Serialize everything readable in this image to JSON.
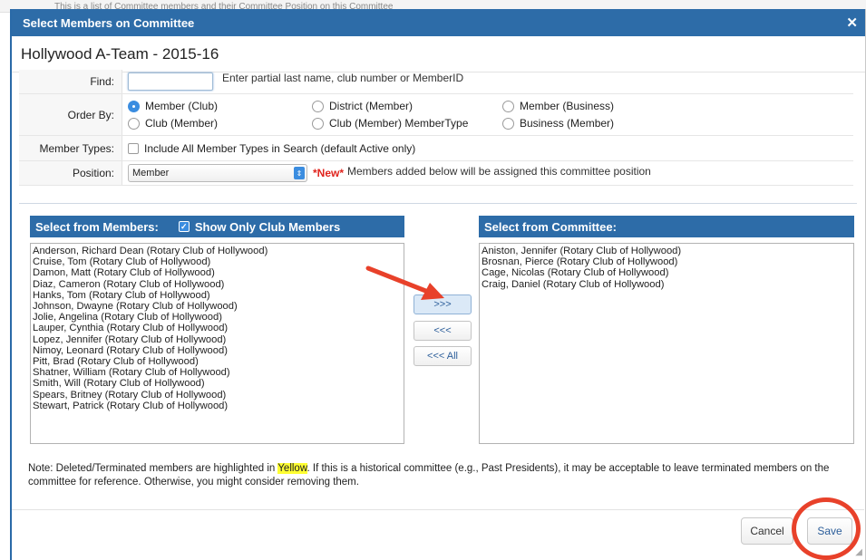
{
  "page": {
    "background_text": "This is a list of Committee members and their Committee Position on this Committee"
  },
  "modal": {
    "title": "Select Members on Committee",
    "close_icon": "close-icon"
  },
  "committee_title": "Hollywood A-Team - 2015-16",
  "form": {
    "find_label": "Find:",
    "find_value": "",
    "find_hint": "Enter partial last name, club number or MemberID",
    "order_by_label": "Order By:",
    "order_options": [
      {
        "label": "Member (Club)",
        "selected": true
      },
      {
        "label": "District (Member)",
        "selected": false
      },
      {
        "label": "Member (Business)",
        "selected": false
      },
      {
        "label": "Club (Member)",
        "selected": false
      },
      {
        "label": "Club (Member) MemberType",
        "selected": false
      },
      {
        "label": "Business (Member)",
        "selected": false
      }
    ],
    "member_types_label": "Member Types:",
    "member_types_checkbox": "Include All Member Types in Search (default Active only)",
    "position_label": "Position:",
    "position_value": "Member",
    "new_tag": "*New*",
    "position_hint": "Members added below will be assigned this committee position"
  },
  "members_panel": {
    "title": "Select from Members:",
    "show_only_label": "Show Only Club Members",
    "show_only_checked": true,
    "items": [
      "Anderson, Richard Dean (Rotary Club of Hollywood)",
      "Cruise, Tom (Rotary Club of Hollywood)",
      "Damon, Matt (Rotary Club of Hollywood)",
      "Diaz, Cameron (Rotary Club of Hollywood)",
      "Hanks, Tom (Rotary Club of Hollywood)",
      "Johnson, Dwayne (Rotary Club of Hollywood)",
      "Jolie, Angelina (Rotary Club of Hollywood)",
      "Lauper, Cynthia (Rotary Club of Hollywood)",
      "Lopez, Jennifer (Rotary Club of Hollywood)",
      "Nimoy, Leonard (Rotary Club of Hollywood)",
      "Pitt, Brad (Rotary Club of Hollywood)",
      "Shatner, William (Rotary Club of Hollywood)",
      "Smith, Will (Rotary Club of Hollywood)",
      "Spears, Britney (Rotary Club of Hollywood)",
      "Stewart, Patrick (Rotary Club of Hollywood)"
    ]
  },
  "committee_panel": {
    "title": "Select from Committee:",
    "items": [
      "Aniston, Jennifer (Rotary Club of Hollywood)",
      "Brosnan, Pierce (Rotary Club of Hollywood)",
      "Cage, Nicolas (Rotary Club of Hollywood)",
      "Craig, Daniel (Rotary Club of Hollywood)"
    ]
  },
  "move_buttons": {
    "add": ">>>",
    "remove": "<<<",
    "remove_all": "<<< All"
  },
  "note": {
    "prefix": "Note: Deleted/Terminated members are highlighted in ",
    "highlight_word": "Yellow",
    "suffix": ". If this is a historical committee (e.g., Past Presidents), it may be acceptable to leave terminated members on the committee for reference. Otherwise, you might consider removing them."
  },
  "footer": {
    "cancel_label": "Cancel",
    "save_label": "Save"
  },
  "colors": {
    "header_blue": "#2d6ca8",
    "accent_blue": "#3b8de0",
    "new_red": "#e0231c",
    "annotation_red": "#e8412a",
    "highlight_yellow": "#ffff33"
  }
}
